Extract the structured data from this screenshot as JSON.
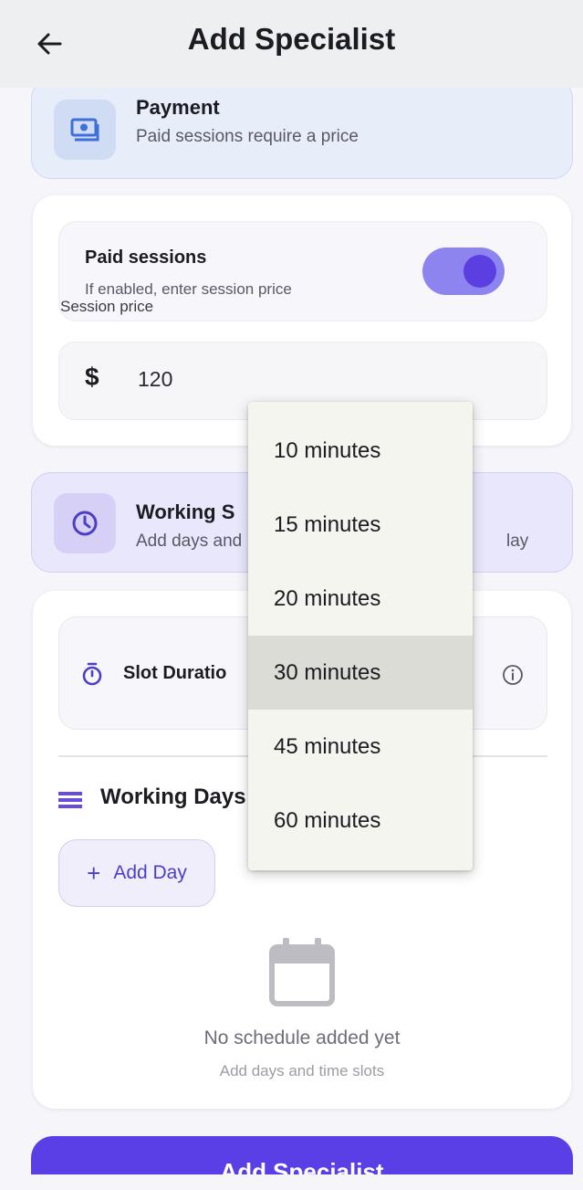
{
  "app_bar": {
    "title": "Add Specialist",
    "back_icon": "arrow-left-icon"
  },
  "payment_section": {
    "title": "Payment",
    "subtitle": "Paid sessions require a price",
    "icon": "cash-icon",
    "paid_toggle": {
      "title": "Paid sessions",
      "subtitle": "If enabled, enter session price",
      "enabled": true
    },
    "price_field": {
      "label": "Session price",
      "currency_symbol": "$",
      "value": "120"
    }
  },
  "schedule_section": {
    "title": "Working S",
    "subtitle": "Add days and",
    "subtitle_tail": "lay",
    "icon": "clock-icon",
    "slot_duration": {
      "label": "Slot Duratio",
      "icon": "stopwatch-icon",
      "info_icon": "info-icon"
    },
    "working_days": {
      "title": "Working Days",
      "icon": "list-icon",
      "add_button": "Add Day"
    },
    "empty_state": {
      "icon": "calendar-icon",
      "title": "No schedule added yet",
      "subtitle": "Add days and time slots"
    }
  },
  "submit_button": {
    "label": "Add Specialist"
  },
  "duration_menu": {
    "options": [
      "10 minutes",
      "15 minutes",
      "20 minutes",
      "30 minutes",
      "45 minutes",
      "60 minutes"
    ],
    "selected": "30 minutes"
  },
  "colors": {
    "primary": "#5a3fe6",
    "switch_track": "#8d84ef",
    "switch_thumb": "#5b3fe0",
    "menu_background": "#f5f5f0",
    "menu_selected": "#dcdcd6"
  }
}
